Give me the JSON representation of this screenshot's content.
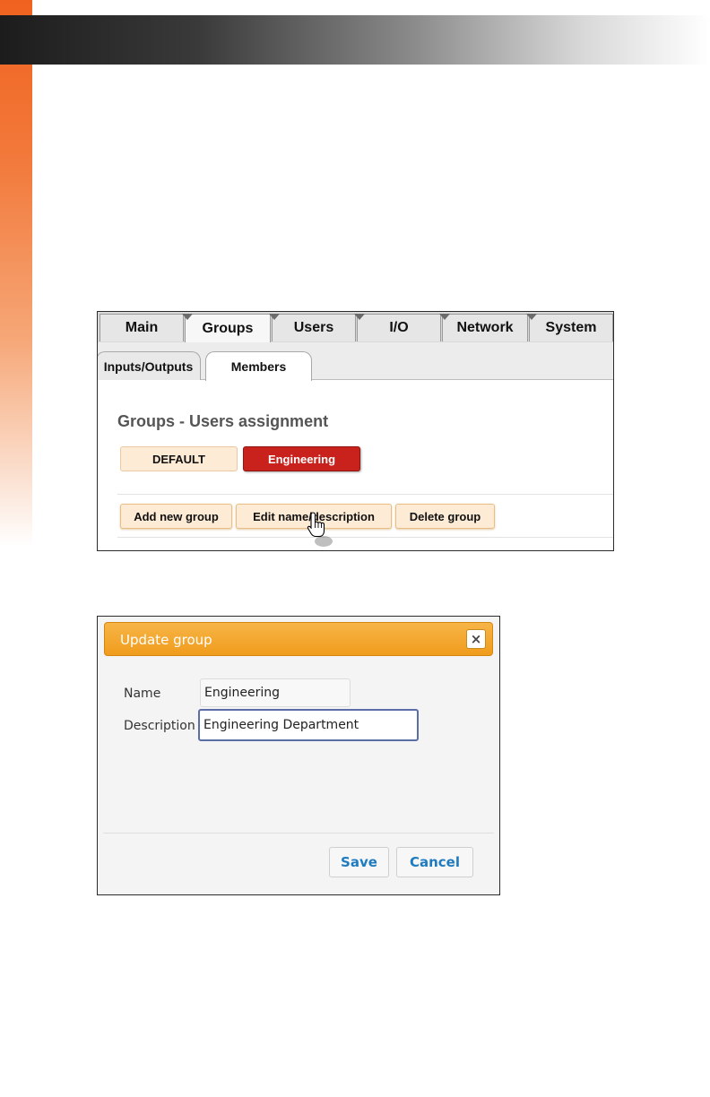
{
  "main_tabs": [
    "Main",
    "Groups",
    "Users",
    "I/O",
    "Network",
    "System"
  ],
  "sub_tabs": [
    "Inputs/Outputs",
    "Members"
  ],
  "section_title": "Groups - Users assignment",
  "groups": [
    "DEFAULT",
    "Engineering"
  ],
  "actions": [
    "Add new group",
    "Edit name/description",
    "Delete group"
  ],
  "dialog": {
    "title": "Update group",
    "close_icon": "×",
    "name_label": "Name",
    "name_value": "Engineering",
    "description_label": "Description",
    "description_value": "Engineering Department",
    "save_label": "Save",
    "cancel_label": "Cancel"
  },
  "colors": {
    "accent_orange": "#f0a22a",
    "selected_group": "#c9211c",
    "button_fill": "#fdebd6",
    "dialog_button_text": "#1e7bbf"
  }
}
